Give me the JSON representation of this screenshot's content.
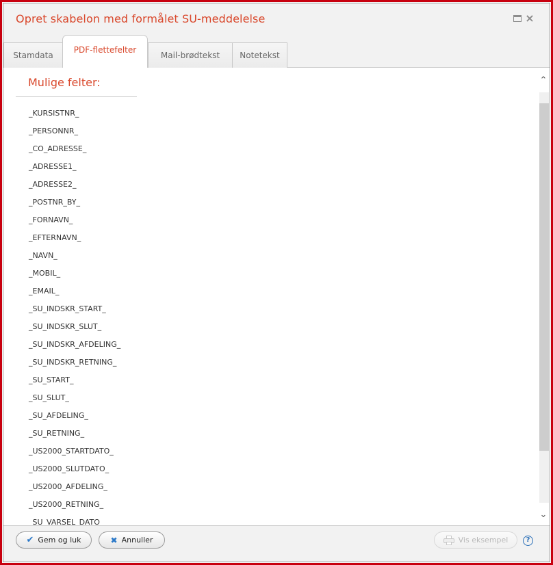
{
  "window": {
    "title": "Opret skabelon med formålet SU-meddelelse",
    "accent_color": "#d9472b",
    "border_color": "#c8000f"
  },
  "tabs": [
    {
      "label": "Stamdata",
      "active": false
    },
    {
      "label": "PDF-flettefelter",
      "active": true
    },
    {
      "label": "Mail-brødtekst",
      "active": false
    },
    {
      "label": "Notetekst",
      "active": false
    }
  ],
  "content": {
    "section_title": "Mulige felter:",
    "fields": [
      "_KURSISTNR_",
      "_PERSONNR_",
      "_CO_ADRESSE_",
      "_ADRESSE1_",
      "_ADRESSE2_",
      "_POSTNR_BY_",
      "_FORNAVN_",
      "_EFTERNAVN_",
      "_NAVN_",
      "_MOBIL_",
      "_EMAIL_",
      "_SU_INDSKR_START_",
      "_SU_INDSKR_SLUT_",
      "_SU_INDSKR_AFDELING_",
      "_SU_INDSKR_RETNING_",
      "_SU_START_",
      "_SU_SLUT_",
      "_SU_AFDELING_",
      "_SU_RETNING_",
      "_US2000_STARTDATO_",
      "_US2000_SLUTDATO_",
      "_US2000_AFDELING_",
      "_US2000_RETNING_",
      "_SU_VARSEL_DATO_"
    ]
  },
  "footer": {
    "save_label": "Gem og luk",
    "cancel_label": "Annuller",
    "preview_label": "Vis eksempel",
    "preview_enabled": false,
    "help_label": "?"
  },
  "icons": {
    "maximize": "maximize-icon",
    "close": "close-icon",
    "save": "check-icon",
    "cancel": "x-icon",
    "preview": "printer-icon",
    "help": "help-icon",
    "scroll_up": "chevron-up-icon",
    "scroll_down": "chevron-down-icon"
  }
}
